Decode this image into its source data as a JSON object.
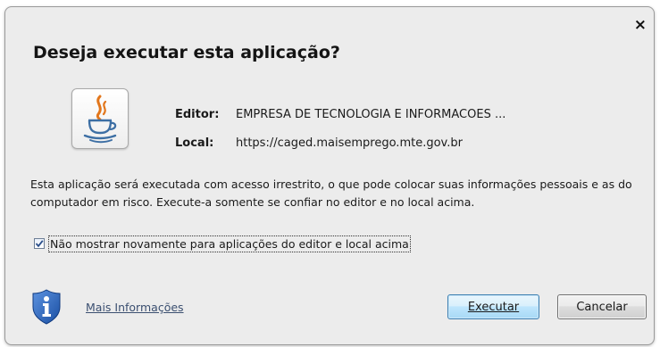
{
  "dialog": {
    "title": "Deseja executar esta aplicação?",
    "close_glyph": "×",
    "publisher": {
      "label": "Editor:",
      "value": "EMPRESA DE TECNOLOGIA E INFORMACOES ..."
    },
    "location": {
      "label": "Local:",
      "value": "https://caged.maisemprego.mte.gov.br"
    },
    "warning": "Esta aplicação será executada com acesso irrestrito, o que pode colocar suas informações pessoais e as do computador em risco. Execute-a somente se confiar no editor e no local acima.",
    "checkbox": {
      "checked": true,
      "label": "Não mostrar novamente para aplicações do editor e local acima"
    },
    "more_info_link": "Mais Informações",
    "buttons": {
      "run": "Executar",
      "cancel": "Cancelar"
    },
    "icons": {
      "app": "java-coffee-cup-icon",
      "security": "shield-info-icon",
      "close": "close-icon"
    },
    "colors": {
      "dialog_bg": "#ececec",
      "link": "#3b4f70",
      "primary_button_border": "#3c7fb1",
      "shield_blue": "#1f5bb5"
    }
  }
}
